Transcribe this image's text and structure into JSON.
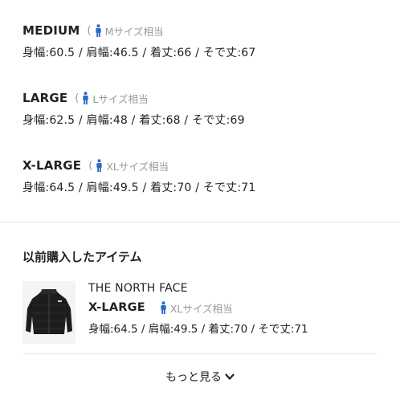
{
  "sizes": [
    {
      "name": "MEDIUM",
      "paren": "(",
      "equiv": "Mサイズ相当",
      "measure": "身幅:60.5 / 肩幅:46.5 / 着丈:66 / そで丈:67"
    },
    {
      "name": "LARGE",
      "paren": "(",
      "equiv": "Lサイズ相当",
      "measure": "身幅:62.5 / 肩幅:48 / 着丈:68 / そで丈:69"
    },
    {
      "name": "X-LARGE",
      "paren": "(",
      "equiv": "XLサイズ相当",
      "measure": "身幅:64.5 / 肩幅:49.5 / 着丈:70 / そで丈:71"
    }
  ],
  "purchased": {
    "title": "以前購入したアイテム",
    "brand": "THE NORTH FACE",
    "size": "X-LARGE",
    "equiv": "XLサイズ相当",
    "measure": "身幅:64.5 / 肩幅:49.5 / 着丈:70 / そで丈:71"
  },
  "more_label": "もっと見る",
  "colors": {
    "accent_icon": "#2b6cc4",
    "muted": "#999999"
  }
}
